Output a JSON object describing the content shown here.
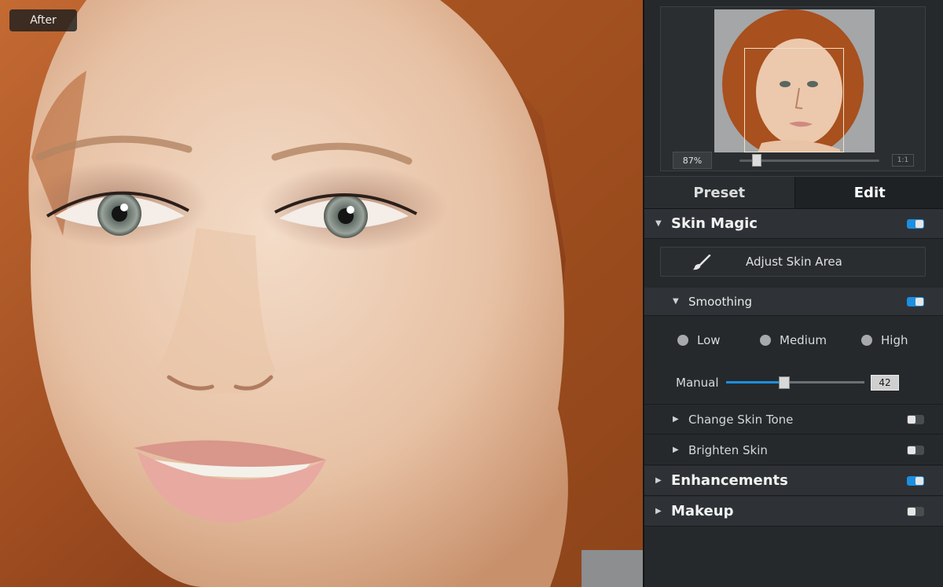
{
  "canvas": {
    "view_label": "After"
  },
  "navigator": {
    "zoom": "87%",
    "zoom_level": 0.12,
    "fit_label": "1:1"
  },
  "tabs": [
    {
      "label": "Preset",
      "active": false
    },
    {
      "label": "Edit",
      "active": true
    }
  ],
  "skin_magic": {
    "title": "Skin Magic",
    "enabled": true,
    "adjust_area_label": "Adjust Skin Area",
    "smoothing": {
      "title": "Smoothing",
      "enabled": true,
      "options": [
        "Low",
        "Medium",
        "High"
      ],
      "manual_label": "Manual",
      "manual_value": "42",
      "manual_level": 0.42
    },
    "change_skin_tone": {
      "title": "Change Skin Tone",
      "enabled": false
    },
    "brighten_skin": {
      "title": "Brighten Skin",
      "enabled": false
    }
  },
  "enhancements": {
    "title": "Enhancements",
    "enabled": true
  },
  "makeup": {
    "title": "Makeup",
    "enabled": false
  },
  "colors": {
    "accent": "#1d8fe0",
    "panel_bg": "#26292c",
    "hair": "#b45a28"
  }
}
